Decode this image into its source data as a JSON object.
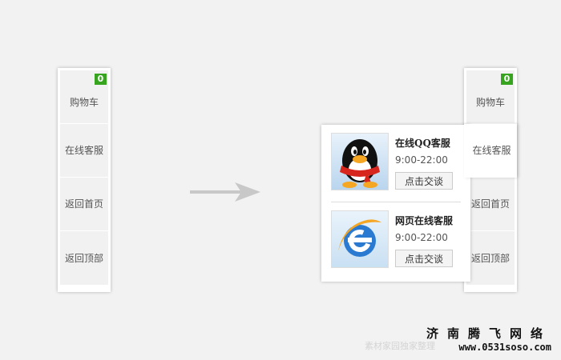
{
  "sidebar_left": {
    "cart_count": "0",
    "items": [
      {
        "label": "购物车"
      },
      {
        "label": "在线客服"
      },
      {
        "label": "返回首页"
      },
      {
        "label": "返回顶部"
      }
    ]
  },
  "sidebar_right": {
    "cart_count": "0",
    "items": [
      {
        "label": "购物车"
      },
      {
        "label": "在线客服"
      },
      {
        "label": "返回首页"
      },
      {
        "label": "返回顶部"
      }
    ]
  },
  "popup": {
    "services": [
      {
        "icon": "qq-penguin-icon",
        "title": "在线QQ客服",
        "hours": "9:00-22:00",
        "button": "点击交谈"
      },
      {
        "icon": "internet-explorer-icon",
        "title": "网页在线客服",
        "hours": "9:00-22:00",
        "button": "点击交谈"
      }
    ]
  },
  "arrow": {
    "icon": "right-arrow-icon"
  },
  "watermark": "素材家园独家整理",
  "brand": {
    "name": "济南腾飞网络",
    "url": "www.0531soso.com"
  },
  "colors": {
    "badge": "#36a41e",
    "background": "#f2f2f2",
    "arrow": "#c8c8c8"
  }
}
